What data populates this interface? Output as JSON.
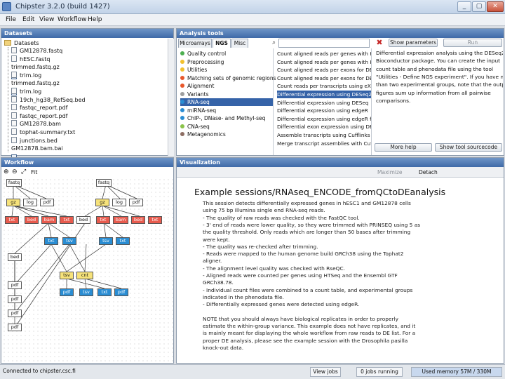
{
  "window": {
    "title": "Chipster 3.2.0 (build 1427)",
    "controls": [
      "_",
      "▢",
      "✕"
    ]
  },
  "menu": [
    "File",
    "Edit",
    "View",
    "Workflow",
    "Help"
  ],
  "datasets": {
    "header": "Datasets",
    "root": "Datasets",
    "items": [
      {
        "name": "GM12878.fastq",
        "type": "file"
      },
      {
        "name": "hESC.fastq",
        "type": "file"
      },
      {
        "name": "trimmed.fastq.gz",
        "type": "tab"
      },
      {
        "name": "trim.log",
        "type": "file"
      },
      {
        "name": "trimmed.fastq.gz",
        "type": "tab"
      },
      {
        "name": "trim.log",
        "type": "file"
      },
      {
        "name": "19ch_hg38_RefSeq.bed",
        "type": "file"
      },
      {
        "name": "fastqc_report.pdf",
        "type": "file"
      },
      {
        "name": "fastqc_report.pdf",
        "type": "file"
      },
      {
        "name": "GM12878.bam",
        "type": "file"
      },
      {
        "name": "tophat-summary.txt",
        "type": "file"
      },
      {
        "name": "junctions.bed",
        "type": "file"
      },
      {
        "name": "GM12878.bam.bai",
        "type": "tab"
      }
    ]
  },
  "analysis": {
    "header": "Analysis tools",
    "tabs": [
      "Microarrays",
      "NGS",
      "Misc"
    ],
    "active_tab": "NGS",
    "show_parameters": "Show parameters",
    "run": "Run",
    "categories": [
      {
        "label": "Quality control",
        "color": "#4caf50"
      },
      {
        "label": "Preprocessing",
        "color": "#f2c12e"
      },
      {
        "label": "Utilities",
        "color": "#f2c12e"
      },
      {
        "label": "Matching sets of genomic regions",
        "color": "#e8572b"
      },
      {
        "label": "Alignment",
        "color": "#e8572b"
      },
      {
        "label": "Variants",
        "color": "#9e9e9e"
      },
      {
        "label": "RNA-seq",
        "color": "#2a8dd3"
      },
      {
        "label": "miRNA-seq",
        "color": "#2a8dd3"
      },
      {
        "label": "ChIP-, DNase- and Methyl-seq",
        "color": "#2a8dd3"
      },
      {
        "label": "CNA-seq",
        "color": "#8bc34a"
      },
      {
        "label": "Metagenomics",
        "color": "#8d6e63"
      }
    ],
    "selected_category": 6,
    "tools": [
      "Count aligned reads per genes with HTSeq",
      "Count aligned reads per genes with HTSeq using own GTF",
      "Count aligned reads per exons for DEXSeq",
      "Count aligned reads per exons for DEXSeq using own GTF",
      "Count reads per transcripts using eXpress",
      "Differential expression using DESeq2",
      "Differential expression using DESeq",
      "Differential expression using edgeR",
      "Differential expression using edgeR for multivariate",
      "Differential exon expression using DEXSeq",
      "Assemble transcripts using Cufflinks",
      "Merge transcript assemblies with Cuffmerge"
    ],
    "selected_tool": 5,
    "description": [
      "Differential expression analysis using the DESeq2",
      "Bioconductor package. You can create the input",
      "count table and phenodata file using the tool",
      "\"Utilities - Define NGS experiment\". If you have more",
      "than two experimental groups, note that the output",
      "figures sum up information from all pairwise",
      "comparisons."
    ],
    "more_help": "More help",
    "show_source": "Show tool sourcecode"
  },
  "workflow": {
    "header": "Workflow",
    "fit_label": "Fit"
  },
  "visualization": {
    "header": "Visualization",
    "maximize": "Maximize",
    "detach": "Detach",
    "title": "Example sessions/RNAseq_ENCODE_fromQCtoDEanalysis",
    "lines": [
      "This session detects differentially expressed genes in hESC1 and GM12878 cells",
      "using 75 bp Illumina single end RNA-seq reads.",
      "- The quality of raw reads was checked with the FastQC tool.",
      "- 3' end of reads were lower quality, so they were trimmed with PRINSEQ using 5 as",
      "the quality threshold. Only reads which are longer than 50 bases after trimming",
      "were kept.",
      "- The quality was re-checked after trimming.",
      "- Reads were mapped to the human genome build GRCh38 using the Tophat2",
      "aligner.",
      "- The alignment level quality was checked with RseQC.",
      "- Aligned reads were counted per genes using HTSeq and the Ensembl GTF",
      "GRCh38.78.",
      "- Individual count files were combined to a count table, and experimental groups",
      "indicated in the phenodata file.",
      "- Differentially expressed genes were detected using edgeR.",
      "",
      "NOTE that you should always have biological replicates in order to properly",
      "estimate the within-group variance. This example does not have replicates, and it",
      "is mainly meant for displaying the whole workflow from raw reads to DE list. For a",
      "proper DE analysis, please see the example session with the Drosophila pasilla",
      "knock-out data."
    ]
  },
  "status": {
    "connection": "Connected to chipster.csc.fi",
    "view_jobs": "View jobs",
    "jobs_running": "0 jobs running",
    "memory": "Used memory 57M / 330M"
  }
}
